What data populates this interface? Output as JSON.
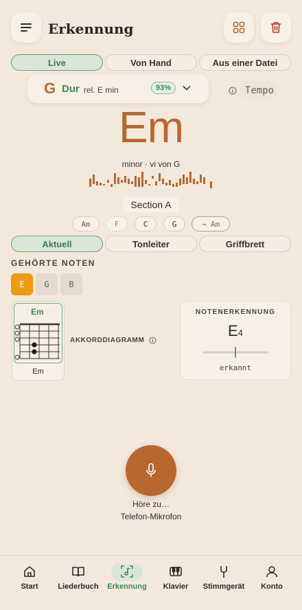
{
  "header": {
    "title": "Erkennung"
  },
  "mode_tabs": [
    {
      "label": "Live",
      "active": true
    },
    {
      "label": "Von Hand",
      "active": false
    },
    {
      "label": "Aus einer Datei",
      "active": false
    }
  ],
  "key": {
    "root": "G",
    "quality": "Dur",
    "relative": "rel. E min",
    "confidence": "93%",
    "tempo_label": "Tempo"
  },
  "chord": {
    "name": "Em",
    "function": "minor · vi von G"
  },
  "section": {
    "label": "Section A"
  },
  "progression": [
    "Am",
    "F",
    "C",
    "G",
    "→ Am"
  ],
  "view_tabs": [
    {
      "label": "Aktuell",
      "active": true
    },
    {
      "label": "Tonleiter",
      "active": false
    },
    {
      "label": "Griffbrett",
      "active": false
    }
  ],
  "heard_notes": {
    "title": "GEHÖRTE NOTEN",
    "notes": [
      "E",
      "G",
      "B"
    ]
  },
  "chord_diagram": {
    "chord": "Em",
    "caption": "Em",
    "label": "AKKORDDIAGRAMM"
  },
  "note_detection": {
    "title": "NOTENERKENNUNG",
    "note": "E",
    "octave": "4",
    "status": "erkannt"
  },
  "listening": {
    "status": "Höre zu…",
    "source": "Telefon-Mikrofon"
  },
  "bottom_nav": [
    {
      "label": "Start",
      "icon": "home-icon"
    },
    {
      "label": "Liederbuch",
      "icon": "book-icon"
    },
    {
      "label": "Erkennung",
      "icon": "recognize-icon",
      "active": true
    },
    {
      "label": "Klavier",
      "icon": "piano-icon"
    },
    {
      "label": "Stimmgerät",
      "icon": "tuning-fork-icon"
    },
    {
      "label": "Konto",
      "icon": "user-icon"
    }
  ],
  "colors": {
    "accent": "#b8672f",
    "green": "#3d8a58",
    "orange": "#ee9a12",
    "background": "#f2e9dc"
  }
}
